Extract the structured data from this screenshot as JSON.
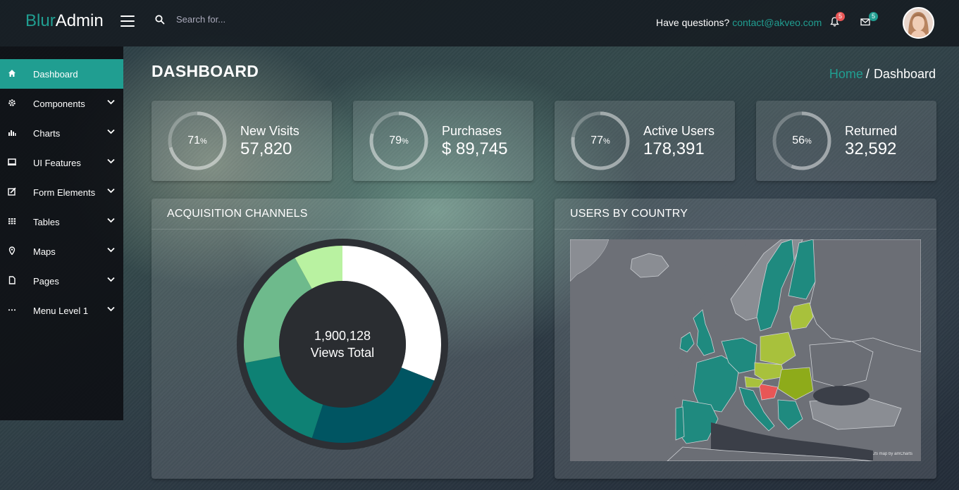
{
  "brand": {
    "part1": "Blur",
    "part2": "Admin"
  },
  "search": {
    "placeholder": "Search for..."
  },
  "header": {
    "questions_text": "Have questions?",
    "contact_email": "contact@akveo.com",
    "notifications_count": "5",
    "messages_count": "5"
  },
  "sidebar": {
    "items": [
      {
        "label": "Dashboard",
        "icon": "home-icon"
      },
      {
        "label": "Components",
        "icon": "gear-icon"
      },
      {
        "label": "Charts",
        "icon": "bar-chart-icon"
      },
      {
        "label": "UI Features",
        "icon": "monitor-icon"
      },
      {
        "label": "Form Elements",
        "icon": "edit-icon"
      },
      {
        "label": "Tables",
        "icon": "grid-icon"
      },
      {
        "label": "Maps",
        "icon": "map-pin-icon"
      },
      {
        "label": "Pages",
        "icon": "file-icon"
      },
      {
        "label": "Menu Level 1",
        "icon": "ellipsis-icon"
      }
    ]
  },
  "page": {
    "title": "DASHBOARD"
  },
  "breadcrumb": {
    "home": "Home",
    "separator": "/",
    "current": "Dashboard"
  },
  "stats": [
    {
      "percent": "71",
      "percent_unit": "%",
      "label": "New Visits",
      "value": "57,820",
      "fraction": 0.71
    },
    {
      "percent": "79",
      "percent_unit": "%",
      "label": "Purchases",
      "value": "$ 89,745",
      "fraction": 0.79
    },
    {
      "percent": "77",
      "percent_unit": "%",
      "label": "Active Users",
      "value": "178,391",
      "fraction": 0.77
    },
    {
      "percent": "56",
      "percent_unit": "%",
      "label": "Returned",
      "value": "32,592",
      "fraction": 0.56
    }
  ],
  "acquisition": {
    "title": "ACQUISITION CHANNELS",
    "center_value": "1,900,128",
    "center_label": "Views Total"
  },
  "country": {
    "title": "USERS BY COUNTRY",
    "credit": "JS map by amCharts"
  },
  "chart_data": {
    "type": "pie",
    "variant": "donut",
    "values": [
      31,
      24,
      17,
      20,
      8
    ],
    "colors": [
      "#ffffff",
      "#005562",
      "#0e8174",
      "#6eba8c",
      "#b9f2a1"
    ]
  },
  "colors": {
    "accent": "#209e91",
    "badge_red": "#e85656",
    "badge_teal": "#209e91"
  }
}
